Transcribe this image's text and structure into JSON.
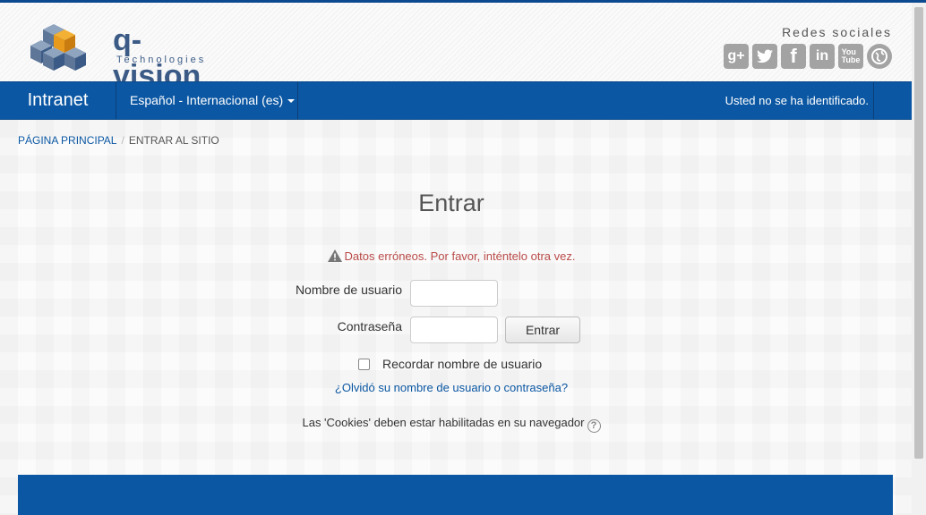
{
  "header": {
    "logo_text": "q-vision",
    "logo_sub": "Technologies",
    "social_title": "Redes sociales",
    "social_icons": [
      {
        "name": "google-plus-icon",
        "glyph": "g+"
      },
      {
        "name": "twitter-icon",
        "glyph": "🐦"
      },
      {
        "name": "facebook-icon",
        "glyph": "f"
      },
      {
        "name": "linkedin-icon",
        "glyph": "in"
      },
      {
        "name": "youtube-icon",
        "glyph": "You"
      },
      {
        "name": "globe-icon",
        "glyph": "●"
      }
    ]
  },
  "navbar": {
    "brand": "Intranet",
    "language": "Español - Internacional (es)",
    "login_status": "Usted no se ha identificado."
  },
  "breadcrumb": {
    "home": "PÁGINA PRINCIPAL",
    "separator": "/",
    "current": "ENTRAR AL SITIO"
  },
  "login": {
    "title": "Entrar",
    "error": "Datos erróneos. Por favor, inténtelo otra vez.",
    "username_label": "Nombre de usuario",
    "username_value": "",
    "password_label": "Contraseña",
    "password_value": "",
    "submit_label": "Entrar",
    "remember_label": "Recordar nombre de usuario",
    "forgot_link": "¿Olvidó su nombre de usuario o contraseña?",
    "cookies_notice": "Las 'Cookies' deben estar habilitadas en su navegador"
  },
  "colors": {
    "primary": "#0b57a3",
    "error": "#b94a48",
    "link": "#0b57a3"
  }
}
